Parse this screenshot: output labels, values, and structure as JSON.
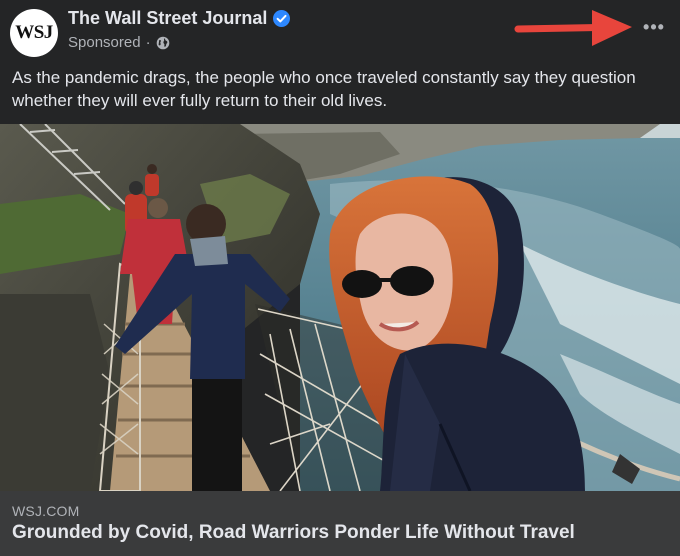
{
  "post": {
    "page": {
      "name": "The Wall Street Journal",
      "avatar_text": "WSJ",
      "verified_icon": "verified-badge-icon",
      "verified_color": "#2d88ff"
    },
    "meta": {
      "sponsored_label": "Sponsored",
      "separator": "·",
      "audience_icon": "globe-icon"
    },
    "more_options": {
      "label": "•••",
      "icon": "more-options-icon"
    },
    "annotation": {
      "icon": "red-arrow-icon",
      "color": "#e8453c"
    },
    "caption": "As the pandemic drags, the people who once traveled constantly say they question whether they will ever fully return to their old lives.",
    "link_preview": {
      "domain": "WSJ.COM",
      "title": "Grounded by Covid, Road Warriors Ponder Life Without Travel"
    }
  },
  "theme": {
    "background": "#242526",
    "link_background": "#3a3b3c",
    "primary_text": "#e4e6eb",
    "secondary_text": "#b0b3b8"
  }
}
